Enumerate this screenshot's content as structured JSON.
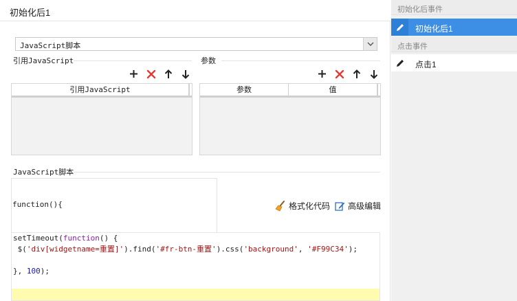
{
  "dialog": {
    "title": "初始化后1",
    "script_type": "JavaScript脚本",
    "ref_section": {
      "label": "引用JavaScript",
      "columns": [
        "引用JavaScript"
      ]
    },
    "param_section": {
      "label": "参数",
      "columns": [
        "参数",
        "值"
      ]
    },
    "toolbar_icons": [
      "plus-icon",
      "delete-icon",
      "arrow-up-icon",
      "arrow-down-icon"
    ],
    "script_section": {
      "label": "JavaScript脚本",
      "function_header": "function(){",
      "format_code_label": "格式化代码",
      "advanced_edit_label": "高级编辑",
      "code_lines": [
        "setTimeout(function() {",
        " $('div[widgetname=重置]').find('#fr-btn-重置').css('background', '#F99C34');",
        "",
        "}, 100);"
      ]
    }
  },
  "events": {
    "init_group_label": "初始化后事件",
    "init_item": "初始化后1",
    "click_group_label": "点击事件",
    "click_item": "点击1"
  },
  "colors": {
    "accent": "#3c8fe4",
    "delete_red": "#e53935",
    "cursor_line": "#fffcb0"
  }
}
